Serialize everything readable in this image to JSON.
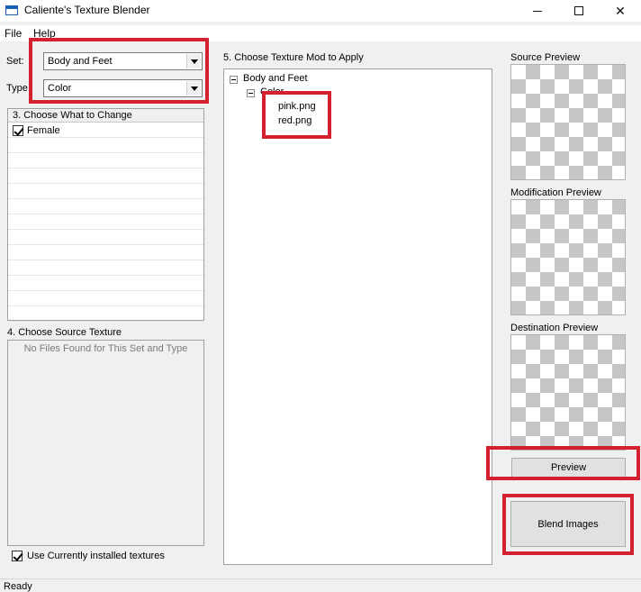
{
  "window": {
    "title": "Caliente's Texture Blender",
    "controls": [
      "minimize",
      "maximize",
      "close"
    ]
  },
  "menu": {
    "items": [
      "File",
      "Help"
    ]
  },
  "set": {
    "label": "Set:",
    "value": "Body and Feet"
  },
  "type": {
    "label": "Type",
    "value": "Color"
  },
  "choose_what": {
    "header": "3. Choose What to Change",
    "items": [
      {
        "label": "Female",
        "checked": true
      }
    ]
  },
  "source_texture": {
    "header": "4. Choose Source Texture",
    "empty_message": "No Files Found for This Set and Type",
    "installed_checkbox_label": "Use Currently installed textures",
    "installed_checked": true
  },
  "texture_mod": {
    "header": "5. Choose Texture Mod to Apply",
    "tree_root": "Body and Feet",
    "tree_child": "Color",
    "files": [
      "pink.png",
      "red.png"
    ]
  },
  "previews": {
    "source_label": "Source Preview",
    "modification_label": "Modification Preview",
    "destination_label": "Destination Preview"
  },
  "buttons": {
    "preview": "Preview",
    "blend": "Blend Images"
  },
  "status": {
    "text": "Ready"
  },
  "highlight_color": "#d3212f"
}
